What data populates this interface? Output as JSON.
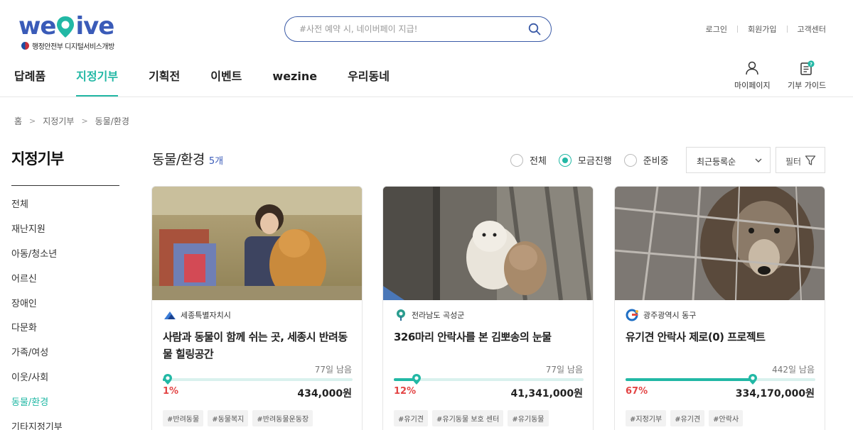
{
  "header": {
    "logo_text_left": "we",
    "logo_text_right": "ive",
    "logo_sub": "행정안전부 디지털서비스개방",
    "search_placeholder": "#사전 예약 시, 네이버페이 지급!",
    "toplinks": [
      "로그인",
      "회원가입",
      "고객센터"
    ],
    "nav": [
      {
        "label": "답례품",
        "active": false
      },
      {
        "label": "지정기부",
        "active": true
      },
      {
        "label": "기획전",
        "active": false
      },
      {
        "label": "이벤트",
        "active": false
      },
      {
        "label": "wezine",
        "active": false
      },
      {
        "label": "우리동네",
        "active": false
      }
    ],
    "mypage_label": "마이페이지",
    "guide_label": "기부 가이드",
    "guide_badge": "?"
  },
  "breadcrumb": [
    "홈",
    "지정기부",
    "동물/환경"
  ],
  "sidebar": {
    "title": "지정기부",
    "items": [
      {
        "label": "전체",
        "active": false
      },
      {
        "label": "재난지원",
        "active": false
      },
      {
        "label": "아동/청소년",
        "active": false
      },
      {
        "label": "어르신",
        "active": false
      },
      {
        "label": "장애인",
        "active": false
      },
      {
        "label": "다문화",
        "active": false
      },
      {
        "label": "가족/여성",
        "active": false
      },
      {
        "label": "이웃/사회",
        "active": false
      },
      {
        "label": "동물/환경",
        "active": true
      },
      {
        "label": "기타지정기부",
        "active": false
      }
    ]
  },
  "main": {
    "title": "동물/환경",
    "count": "5개",
    "radios": [
      {
        "label": "전체",
        "checked": false
      },
      {
        "label": "모금진행",
        "checked": true
      },
      {
        "label": "준비중",
        "checked": false
      }
    ],
    "sort_selected": "최근등록순",
    "filter_label": "필터"
  },
  "cards": [
    {
      "org": "세종특별자치시",
      "title": "사람과 동물이 함께 쉬는 곳, 세종시 반려동물 힐링공간",
      "days_left": "77일 남음",
      "progress": 0.01,
      "percent": "1%",
      "amount": "434,000원",
      "tags": [
        "#반려동물",
        "#동물복지",
        "#반려동물운동장"
      ]
    },
    {
      "org": "전라남도 곡성군",
      "title": "326마리 안락사를 본 김뽀송의 눈물",
      "days_left": "77일 남음",
      "progress": 0.12,
      "percent": "12%",
      "amount": "41,341,000원",
      "tags": [
        "#유기견",
        "#유기동물 보호 센터",
        "#유기동물"
      ]
    },
    {
      "org": "광주광역시 동구",
      "title": "유기견 안락사 제로(0) 프로젝트",
      "days_left": "442일 남음",
      "progress": 0.67,
      "percent": "67%",
      "amount": "334,170,000원",
      "tags": [
        "#지정기부",
        "#유기견",
        "#안락사"
      ]
    }
  ],
  "colors": {
    "brand_blue": "#3a5bb8",
    "accent_teal": "#22b8a5",
    "percent_red": "#e34545"
  }
}
